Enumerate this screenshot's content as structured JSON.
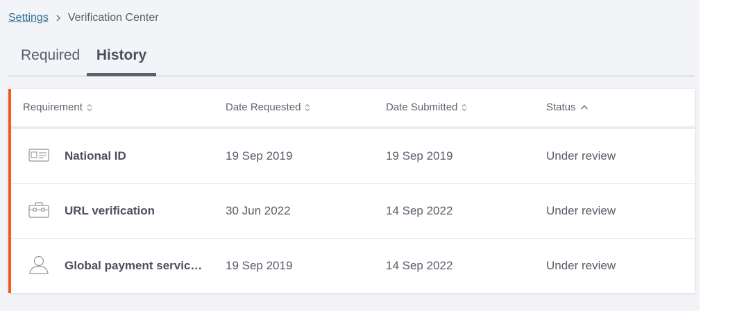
{
  "breadcrumb": {
    "link": "Settings",
    "current": "Verification Center"
  },
  "tabs": [
    {
      "label": "Required",
      "active": false
    },
    {
      "label": "History",
      "active": true
    }
  ],
  "table": {
    "columns": [
      {
        "label": "Requirement",
        "sort": "unsorted"
      },
      {
        "label": "Date Requested",
        "sort": "unsorted"
      },
      {
        "label": "Date Submitted",
        "sort": "unsorted"
      },
      {
        "label": "Status",
        "sort": "ascending"
      }
    ],
    "rows": [
      {
        "icon": "id-card-icon",
        "name": "National ID",
        "date_requested": "19 Sep 2019",
        "date_submitted": "19 Sep 2019",
        "status": "Under review"
      },
      {
        "icon": "briefcase-icon",
        "name": "URL verification",
        "date_requested": "30 Jun 2022",
        "date_submitted": "14 Sep 2022",
        "status": "Under review"
      },
      {
        "icon": "user-icon",
        "name": "Global payment service q...",
        "date_requested": "19 Sep 2019",
        "date_submitted": "14 Sep 2022",
        "status": "Under review"
      }
    ]
  },
  "colors": {
    "accent": "#f35a1f",
    "link": "#2e6f93",
    "background": "#f3f4f7"
  }
}
